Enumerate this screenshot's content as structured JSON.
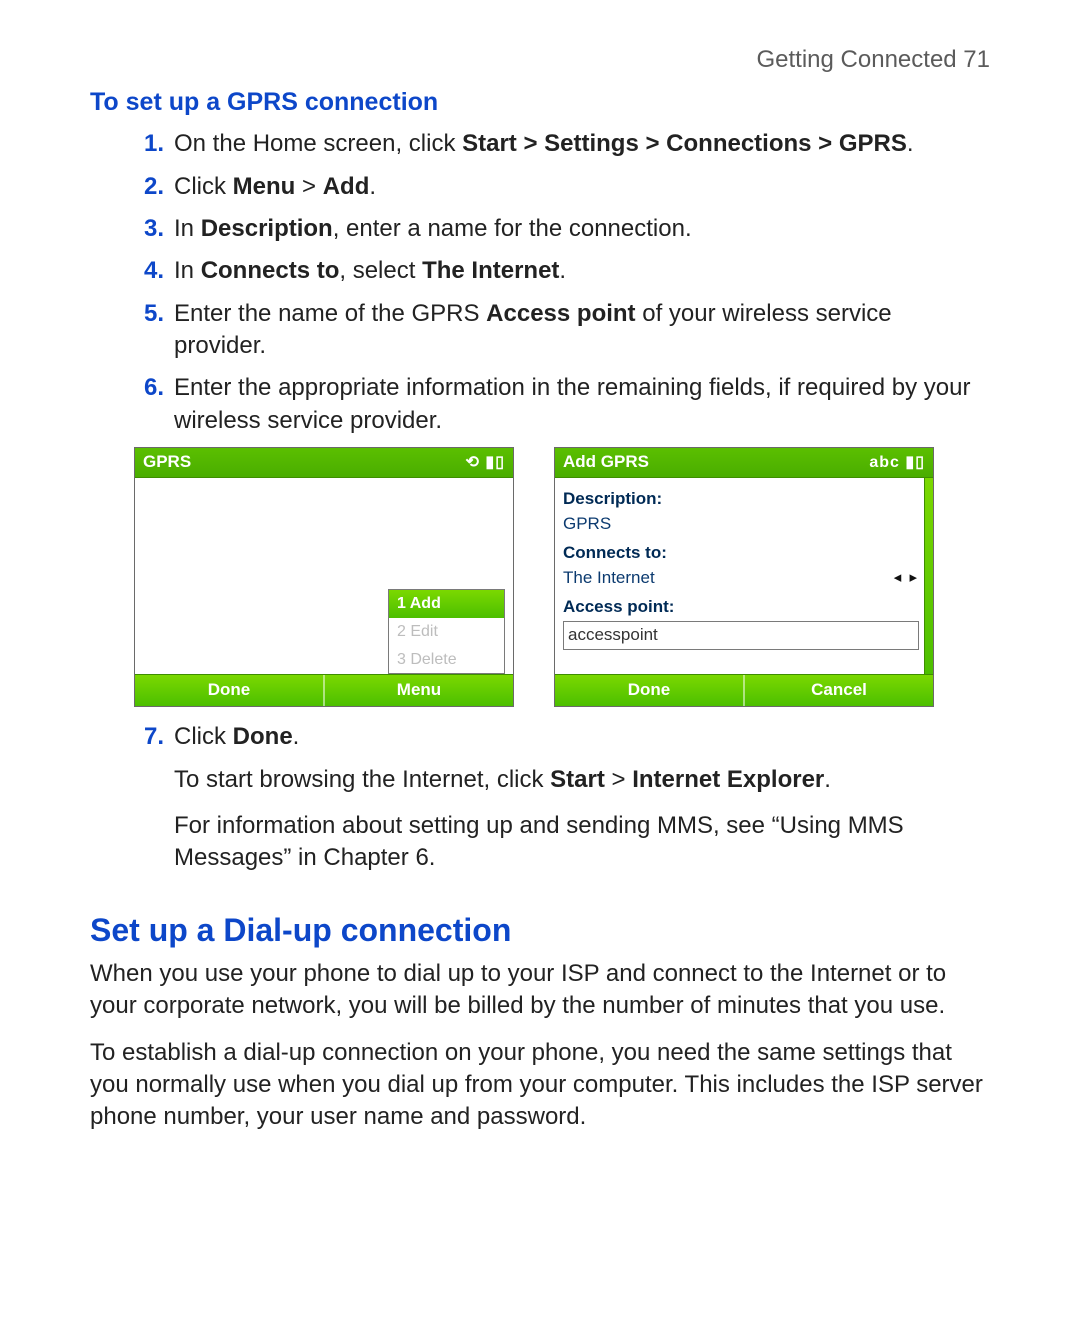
{
  "header": {
    "running": "Getting Connected  71"
  },
  "gprs": {
    "heading": "To set up a GPRS connection",
    "steps": {
      "s1": {
        "num": "1.",
        "pre": "On the Home screen, click ",
        "bold": "Start > Settings > Connections > GPRS",
        "post": "."
      },
      "s2": {
        "num": "2.",
        "pre": "Click ",
        "bold1": "Menu",
        "mid": " > ",
        "bold2": "Add",
        "post": "."
      },
      "s3": {
        "num": "3.",
        "pre": "In ",
        "bold": "Description",
        "post": ", enter a name for the connection."
      },
      "s4": {
        "num": "4.",
        "pre": "In ",
        "bold1": "Connects to",
        "mid": ", select ",
        "bold2": "The Internet",
        "post": "."
      },
      "s5": {
        "num": "5.",
        "pre": "Enter the name of the GPRS ",
        "bold": "Access point",
        "post": " of your wireless service provider."
      },
      "s6": {
        "num": "6.",
        "text": "Enter the appropriate information in the remaining fields, if required by your wireless service provider."
      },
      "s7": {
        "num": "7.",
        "pre": "Click ",
        "bold": "Done",
        "post": "."
      }
    },
    "after7a": {
      "pre": "To start browsing the Internet, click ",
      "bold1": "Start",
      "mid": " > ",
      "bold2": "Internet Explorer",
      "post": "."
    },
    "after7b": "For information about setting up and sending MMS, see “Using MMS Messages” in Chapter 6."
  },
  "screens": {
    "left": {
      "title": "GPRS",
      "status_icons": "⟲ ▮▯",
      "menu": {
        "item1": "1 Add",
        "item2": "2 Edit",
        "item3": "3 Delete"
      },
      "soft_left": "Done",
      "soft_right": "Menu"
    },
    "right": {
      "title": "Add GPRS",
      "status_icons": "abc ▮▯",
      "label_desc": "Description:",
      "value_desc": "GPRS",
      "label_conn": "Connects to:",
      "value_conn": "The Internet",
      "label_ap": "Access point:",
      "value_ap": "accesspoint",
      "soft_left": "Done",
      "soft_right": "Cancel"
    }
  },
  "dialup": {
    "heading": "Set up a Dial-up connection",
    "p1": "When you use your phone to dial up to your ISP and connect to the Internet or to your corporate network, you will be billed by the number of minutes that you use.",
    "p2": "To establish a dial-up connection on your phone, you need the same settings that you normally use when you dial up from your computer. This includes the ISP server phone number, your user name and password."
  }
}
